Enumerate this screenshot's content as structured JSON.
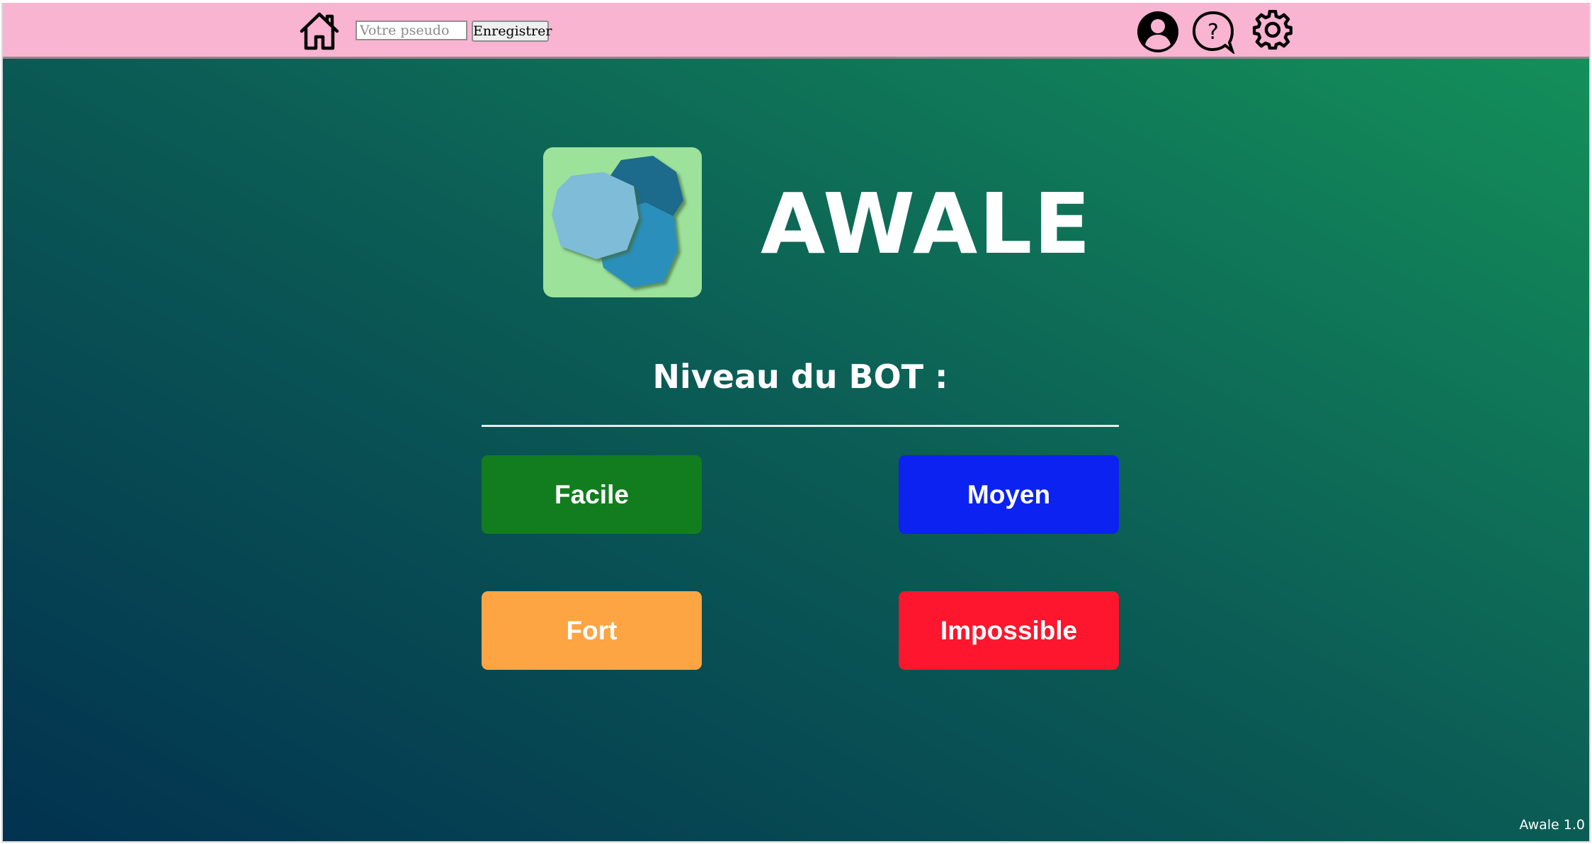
{
  "topbar": {
    "home_icon": "home-icon",
    "pseudo_placeholder": "Votre pseudo",
    "pseudo_value": "",
    "save_label": "Enregistrer",
    "profile_icon": "user-circle-icon",
    "help_icon": "question-bubble-icon",
    "settings_icon": "gear-icon",
    "background_color": "#f9b4d2"
  },
  "header": {
    "app_title": "AWALE",
    "logo_icon": "awale-seeds-logo"
  },
  "level_section": {
    "title": "Niveau du BOT  :",
    "buttons": [
      {
        "label": "Facile",
        "color": "#127d1f"
      },
      {
        "label": "Moyen",
        "color": "#0b22f0"
      },
      {
        "label": "Fort",
        "color": "#fca542"
      },
      {
        "label": "Impossible",
        "color": "#fe152e"
      }
    ]
  },
  "footer": {
    "version": "Awale 1.0"
  },
  "colors": {
    "gradient_start": "#023250",
    "gradient_mid": "#0b5c55",
    "gradient_end": "#14935a",
    "logo_bg": "#9de29b"
  }
}
